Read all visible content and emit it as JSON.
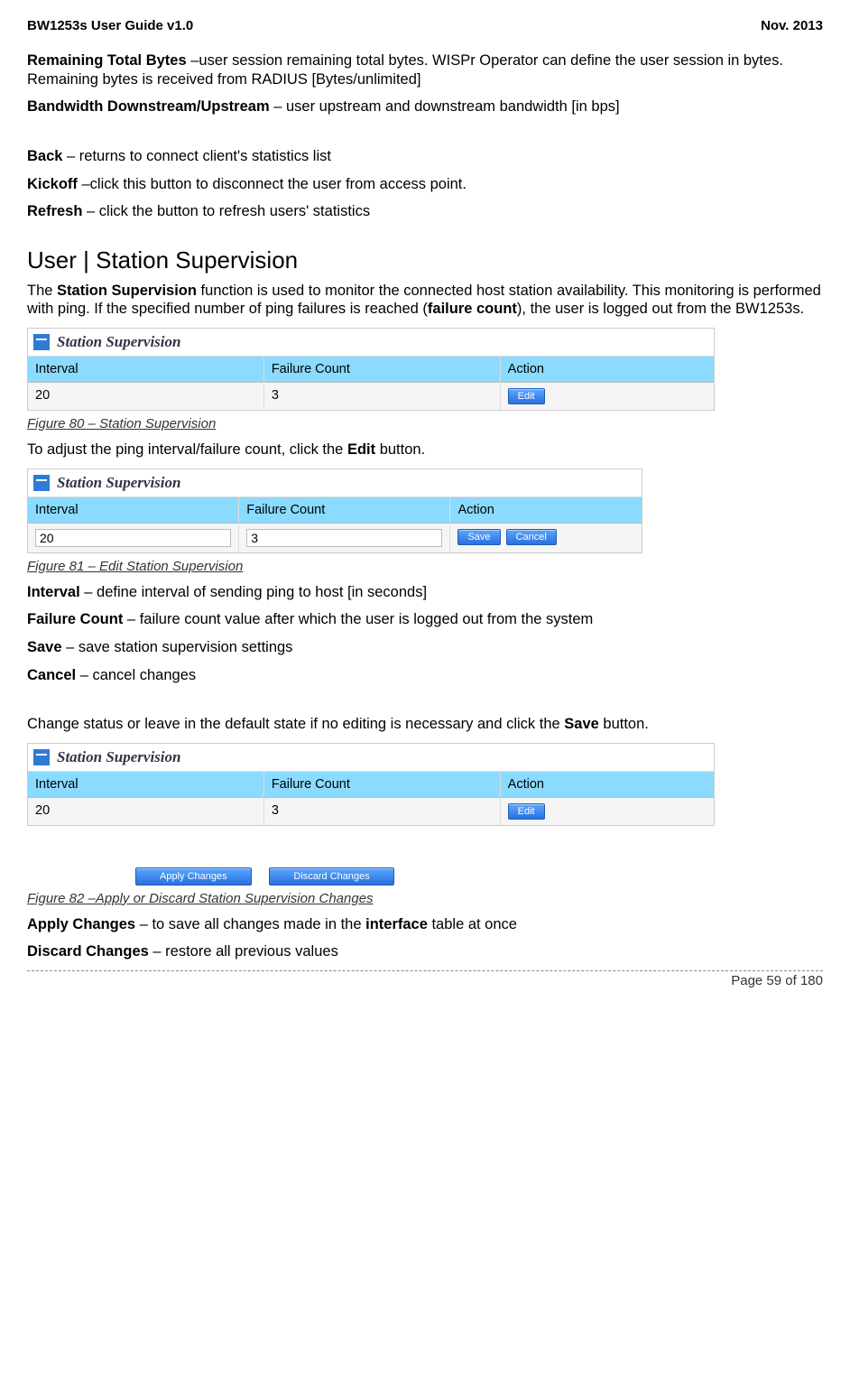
{
  "header": {
    "left": "BW1253s User Guide v1.0",
    "right": "Nov.  2013"
  },
  "defs": {
    "remaining_total_bytes_label": "Remaining Total Bytes",
    "remaining_total_bytes_text": " –user session remaining total bytes. WISPr Operator can define the user session in bytes. Remaining bytes is received from RADIUS [Bytes/unlimited]",
    "bandwidth_label": "Bandwidth Downstream/Upstream",
    "bandwidth_text": " – user upstream and downstream bandwidth [in bps]",
    "back_label": "Back",
    "back_text": " – returns to connect client's statistics list",
    "kickoff_label": "Kickoff",
    "kickoff_text": " –click this button to disconnect the user from access point.",
    "refresh_label": "Refresh",
    "refresh_text": " – click the button to refresh users' statistics"
  },
  "section_title": "User | Station Supervision",
  "intro": {
    "part1": "The ",
    "bold1": "Station Supervision",
    "part2": " function is used to monitor the connected host station availability. This monitoring is performed with ping. If the specified number of ping failures is reached (",
    "bold2": "failure count",
    "part3": "), the user is logged out from the BW1253s."
  },
  "panel": {
    "title": "Station Supervision",
    "cols": {
      "interval": "Interval",
      "failure": "Failure Count",
      "action": "Action"
    },
    "row1": {
      "interval": "20",
      "failure": "3"
    },
    "buttons": {
      "edit": "Edit",
      "save": "Save",
      "cancel": "Cancel"
    }
  },
  "captions": {
    "fig80": "Figure 80 – Station Supervision",
    "fig81": "Figure 81 – Edit Station Supervision",
    "fig82": "Figure 82 –Apply or Discard Station Supervision Changes"
  },
  "adjust_text": {
    "part1": "To adjust the ping interval/failure count, click the ",
    "bold": "Edit",
    "part2": " button."
  },
  "defs2": {
    "interval_label": "Interval",
    "interval_text": " – define interval of sending ping to host [in seconds]",
    "failure_label": "Failure Count",
    "failure_text": " – failure count value after which the user is logged out from the system",
    "save_label": "Save",
    "save_text": " – save station supervision settings",
    "cancel_label": "Cancel",
    "cancel_text": " – cancel changes"
  },
  "change_status": {
    "part1": "Change status or leave in the default state if no editing is necessary and click the ",
    "bold": "Save",
    "part2": " button."
  },
  "apply_buttons": {
    "apply": "Apply Changes",
    "discard": "Discard Changes"
  },
  "defs3": {
    "apply_label": "Apply Changes",
    "apply_text1": " – to save all changes made in the ",
    "apply_bold": "interface",
    "apply_text2": " table at once",
    "discard_label": "Discard Changes",
    "discard_text": " – restore all previous values"
  },
  "footer": "Page 59 of 180"
}
